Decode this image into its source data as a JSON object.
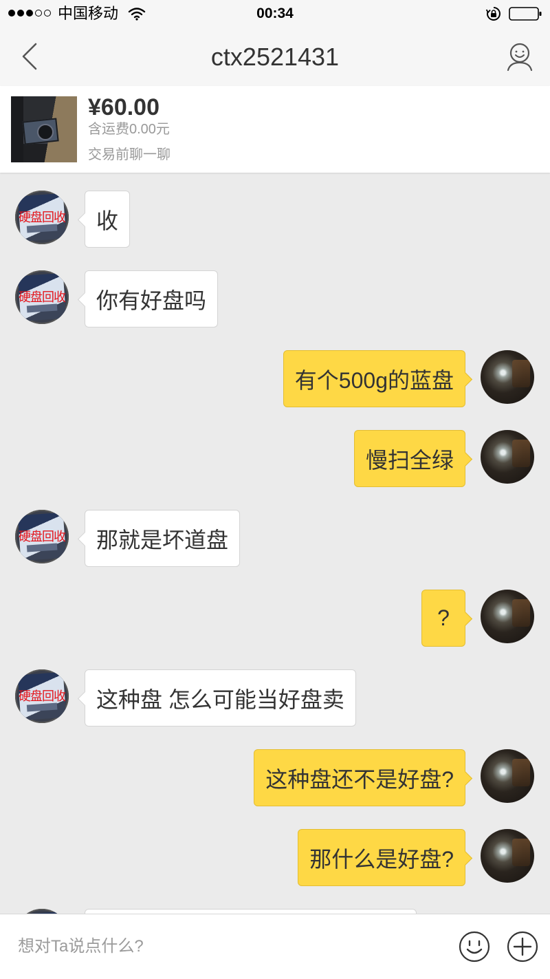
{
  "status_bar": {
    "signal": {
      "filled": 3,
      "total": 5
    },
    "carrier": "中国移动",
    "time": "00:34"
  },
  "nav": {
    "title": "ctx2521431",
    "back_icon": "chevron-left-icon",
    "profile_icon": "user-smile-icon"
  },
  "product": {
    "price": "¥60.00",
    "shipping": "含运费0.00元",
    "hint": "交易前聊一聊"
  },
  "contact": {
    "avatar_label": "硬盘回收"
  },
  "messages": [
    {
      "from_me": false,
      "text": "收"
    },
    {
      "from_me": false,
      "text": "你有好盘吗"
    },
    {
      "from_me": true,
      "text": "有个500g的蓝盘"
    },
    {
      "from_me": true,
      "text": "慢扫全绿"
    },
    {
      "from_me": false,
      "text": "那就是坏道盘"
    },
    {
      "from_me": true,
      "text": "?"
    },
    {
      "from_me": false,
      "text": "这种盘 怎么可能当好盘卖"
    },
    {
      "from_me": true,
      "text": "这种盘还不是好盘?"
    },
    {
      "from_me": true,
      "text": "那什么是好盘?"
    }
  ],
  "input": {
    "placeholder": "想对Ta说点什么?",
    "emoji_icon": "smile-icon",
    "more_icon": "plus-circle-icon"
  },
  "colors": {
    "my_bubble": "#fed845",
    "contact_bubble": "#ffffff",
    "chat_background": "#ebebeb"
  }
}
